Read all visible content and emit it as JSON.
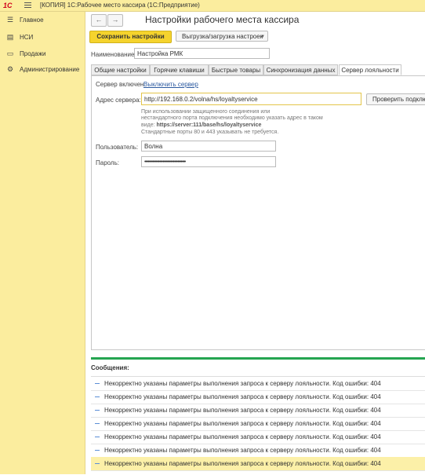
{
  "app": {
    "logo": "1С",
    "title": "[КОПИЯ] 1С:Рабочее место кассира  (1С:Предприятие)"
  },
  "sidebar": {
    "items": [
      {
        "label": "Главное",
        "icon": "☰"
      },
      {
        "label": "НСИ",
        "icon": "▤"
      },
      {
        "label": "Продажи",
        "icon": "▭"
      },
      {
        "label": "Администрирование",
        "icon": "⚙"
      }
    ]
  },
  "nav": {
    "back": "←",
    "forward": "→"
  },
  "form": {
    "title": "Настройки рабочего места кассира",
    "save_label": "Сохранить настройки",
    "export_label": "Выгрузка/загрузка настроек",
    "name_label": "Наименование:",
    "name_value": "Настройка РМК"
  },
  "tabs": [
    {
      "label": "Общие настройки"
    },
    {
      "label": "Горячие клавиши"
    },
    {
      "label": "Быстрые товары"
    },
    {
      "label": "Синхронизация данных"
    },
    {
      "label": "Сервер лояльности"
    }
  ],
  "loyalty": {
    "status_text": "Сервер включен.",
    "disable_link": "Выключить сервер",
    "address_label": "Адрес сервера:",
    "address_value": "http://192.168.0.2/volna/hs/loyaltyservice",
    "check_button": "Проверить подключение",
    "hint_line1": "При использовании защищенного соединения или",
    "hint_line2": "нестандартного порта подключения необходимо указать адрес в таком",
    "hint_line3_prefix": "виде: ",
    "hint_line3_url": "https://server:111/base/hs/loyaltyservice",
    "hint_line4": "Стандартные порты 80 и 443 указывать не требуется.",
    "user_label": "Пользователь:",
    "user_value": "Волна",
    "password_label": "Пароль:",
    "password_value": "••••••••••••••••••••••••••••••••••••"
  },
  "messages": {
    "title": "Сообщения:",
    "items": [
      "Некорректно указаны параметры выполнения запроса к серверу лояльности. Код ошибки: 404",
      "Некорректно указаны параметры выполнения запроса к серверу лояльности. Код ошибки: 404",
      "Некорректно указаны параметры выполнения запроса к серверу лояльности. Код ошибки: 404",
      "Некорректно указаны параметры выполнения запроса к серверу лояльности. Код ошибки: 404",
      "Некорректно указаны параметры выполнения запроса к серверу лояльности. Код ошибки: 404",
      "Некорректно указаны параметры выполнения запроса к серверу лояльности. Код ошибки: 404",
      "Некорректно указаны параметры выполнения запроса к серверу лояльности. Код ошибки: 404"
    ],
    "selected_index": 6
  },
  "colors": {
    "accent": "#f5d32d",
    "sidebar_bg": "#fbed9e",
    "status_green": "#25a551",
    "link": "#2c5aa0"
  }
}
